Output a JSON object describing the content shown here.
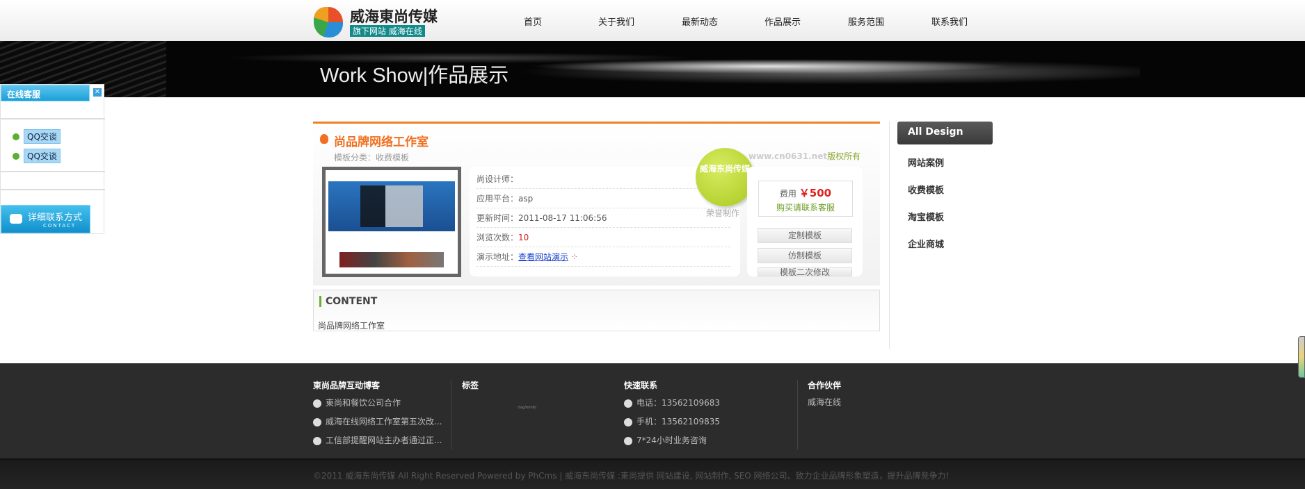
{
  "header": {
    "logo_name": "威海東尚传媒",
    "logo_sub": "旗下网站  威海在线",
    "nav": [
      "首页",
      "关于我们",
      "最新动态",
      "作品展示",
      "服务范围",
      "联系我们"
    ]
  },
  "banner": {
    "title": "Work Show|作品展示"
  },
  "online_service": {
    "title": "在线客服",
    "close": "✕",
    "qq_buttons": [
      "QQ交谈",
      "QQ交谈"
    ],
    "contact_label": "详细联系方式",
    "contact_sub": "CONTACT"
  },
  "product": {
    "title": "尚品牌网络工作室",
    "category": "模板分类：收费模板",
    "watermark_site": "www.cn0631.net",
    "watermark_suffix": "版权所有",
    "rows": [
      {
        "label": "尚设计师：",
        "value": ""
      },
      {
        "label": "应用平台：",
        "value": "asp"
      },
      {
        "label": "更新时间：",
        "value": "2011-08-17 11:06:56"
      },
      {
        "label": "浏览次数：",
        "value": "10"
      },
      {
        "label": "演示地址：",
        "value": "查看网站演示"
      }
    ],
    "sticker": "威海东尚传媒",
    "sticker_sub": "荣誉制作",
    "price_label": "费用",
    "price": "￥500",
    "buy": "购买请联系客服",
    "buttons": [
      "定制模板",
      "仿制模板",
      "模板二次修改"
    ]
  },
  "content": {
    "heading": "CONTENT",
    "text": "尚品牌网络工作室"
  },
  "sidebar": {
    "active": "All Design",
    "items": [
      "网站案例",
      "收费模板",
      "淘宝模板",
      "企业商城"
    ]
  },
  "footer": {
    "blog": {
      "title": "東尚品牌互动博客",
      "items": [
        "東尚和餐饮公司合作",
        "威海在线网络工作室第五次改...",
        "工信部提醒网站主办者通过正..."
      ]
    },
    "tags": {
      "title": "标签",
      "text": "(tag/tomb)"
    },
    "contact": {
      "title": "快速联系",
      "items": [
        "电话：13562109683",
        "手机：13562109835",
        "7*24小时业务咨询"
      ]
    },
    "partners": {
      "title": "合作伙伴",
      "items": [
        "威海在线"
      ]
    },
    "copyright": "©2011 威海东尚传媒 All Right Reserved Powered by PhCms | 威海东尚传媒 :東尚提供 网站建设, 网站制作, SEO 网络公司、致力企业品牌形象塑造，提升品牌竞争力!"
  }
}
